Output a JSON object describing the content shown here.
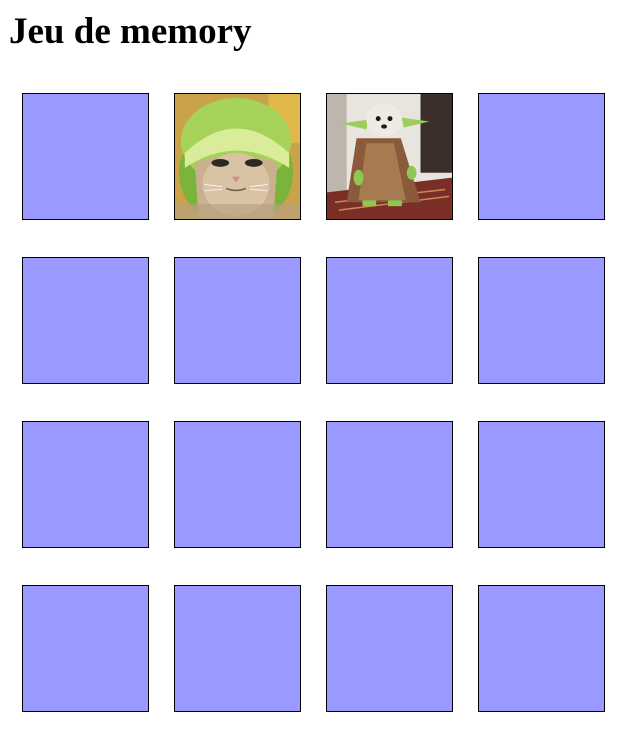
{
  "page": {
    "title": "Jeu de memory"
  },
  "colors": {
    "card_back": "#9999ff",
    "card_border": "#000000",
    "background": "#ffffff"
  },
  "board": {
    "rows": 4,
    "columns": 4,
    "cards": [
      {
        "state": "face-down",
        "image": ""
      },
      {
        "state": "face-up",
        "image": "cat-in-lime-helmet"
      },
      {
        "state": "face-up",
        "image": "dog-in-yoda-costume"
      },
      {
        "state": "face-down",
        "image": ""
      },
      {
        "state": "face-down",
        "image": ""
      },
      {
        "state": "face-down",
        "image": ""
      },
      {
        "state": "face-down",
        "image": ""
      },
      {
        "state": "face-down",
        "image": ""
      },
      {
        "state": "face-down",
        "image": ""
      },
      {
        "state": "face-down",
        "image": ""
      },
      {
        "state": "face-down",
        "image": ""
      },
      {
        "state": "face-down",
        "image": ""
      },
      {
        "state": "face-down",
        "image": ""
      },
      {
        "state": "face-down",
        "image": ""
      },
      {
        "state": "face-down",
        "image": ""
      },
      {
        "state": "face-down",
        "image": ""
      }
    ]
  }
}
